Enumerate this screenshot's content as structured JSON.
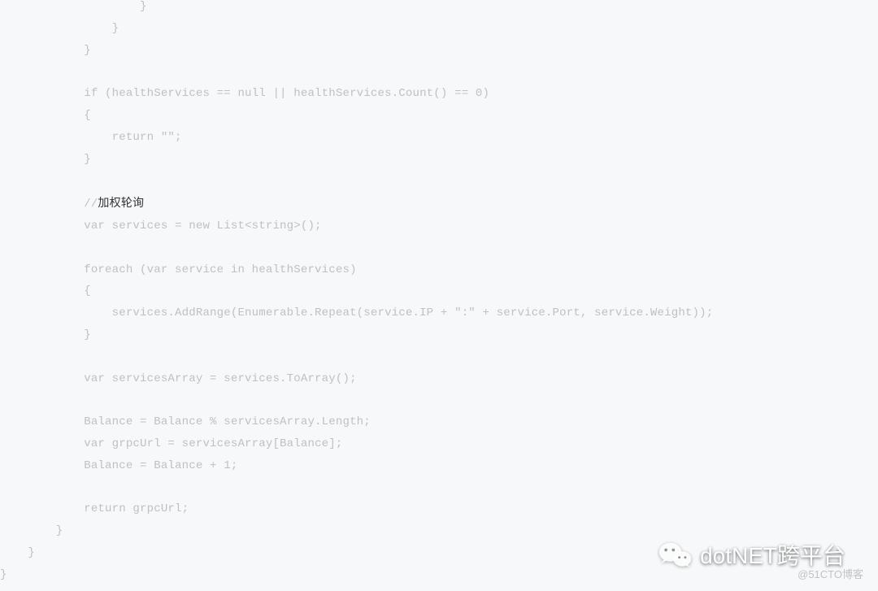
{
  "code": {
    "lines": [
      "                    }",
      "                }",
      "            }",
      "",
      "            if (healthServices == null || healthServices.Count() == 0)",
      "            {",
      "                return \"\";",
      "            }",
      "",
      "            //加权轮询",
      "            var services = new List<string>();",
      "",
      "            foreach (var service in healthServices)",
      "            {",
      "                services.AddRange(Enumerable.Repeat(service.IP + \":\" + service.Port, service.Weight));",
      "            }",
      "",
      "            var servicesArray = services.ToArray();",
      "",
      "            Balance = Balance % servicesArray.Length;",
      "            var grpcUrl = servicesArray[Balance];",
      "            Balance = Balance + 1;",
      "",
      "            return grpcUrl;",
      "        }",
      "    }",
      "}"
    ],
    "comment_text": "加权轮询"
  },
  "watermark": {
    "brand": "dotNET跨平台",
    "credit": "@51CTO博客"
  }
}
